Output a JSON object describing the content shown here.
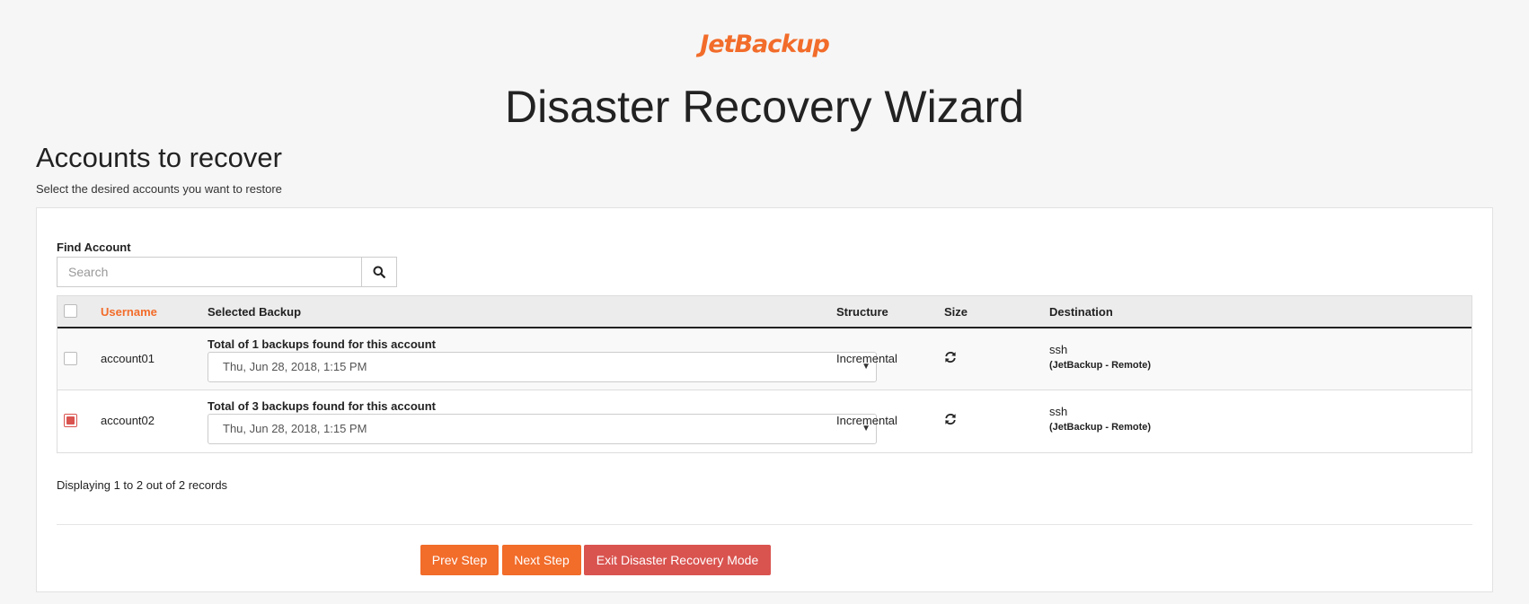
{
  "brand": {
    "logo_text": "JetBackup",
    "accent": "#f26c2a",
    "danger": "#d9534f"
  },
  "page": {
    "title": "Disaster Recovery Wizard",
    "section_title": "Accounts to recover",
    "section_subtitle": "Select the desired accounts you want to restore"
  },
  "search": {
    "label": "Find Account",
    "placeholder": "Search",
    "icon": "search-icon"
  },
  "table": {
    "headers": {
      "username": "Username",
      "selected_backup": "Selected Backup",
      "structure": "Structure",
      "size": "Size",
      "destination": "Destination"
    },
    "rows": [
      {
        "checked": false,
        "username": "account01",
        "backups_found": "Total of 1 backups found for this account",
        "selected_backup": "Thu, Jun 28, 2018, 1:15 PM",
        "structure": "Incremental",
        "size_icon": "refresh-icon",
        "destination": "ssh",
        "destination_detail": "(JetBackup - Remote)"
      },
      {
        "checked": true,
        "username": "account02",
        "backups_found": "Total of 3 backups found for this account",
        "selected_backup": "Thu, Jun 28, 2018, 1:15 PM",
        "structure": "Incremental",
        "size_icon": "refresh-icon",
        "destination": "ssh",
        "destination_detail": "(JetBackup - Remote)"
      }
    ]
  },
  "records_text": "Displaying 1 to 2 out of 2 records",
  "buttons": {
    "prev": "Prev Step",
    "next": "Next Step",
    "exit": "Exit Disaster Recovery Mode"
  }
}
